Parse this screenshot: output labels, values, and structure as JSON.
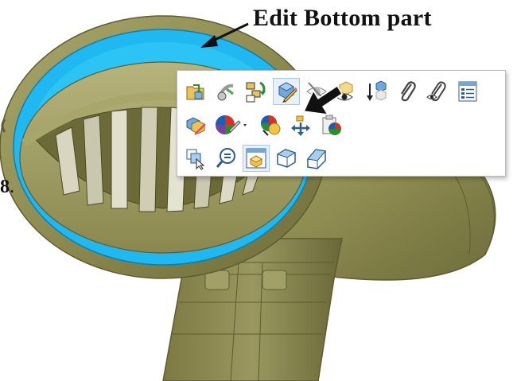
{
  "callout": {
    "text": "Edit Bottom part"
  },
  "step": {
    "number": "8",
    "suffix": "."
  },
  "colors": {
    "part_body": "#8c8a4e",
    "part_edge": "#5e5c30",
    "highlight_face": "#1fb8f0",
    "toolbar_bg": "#ffffff",
    "toolbar_border": "#b9b9b9",
    "hover_bg": "#e8f1fb"
  },
  "toolbar": {
    "rows": [
      {
        "icons": [
          "open-part-icon",
          "smart-mates-icon",
          "assembly-structure-icon",
          "edit-part-icon",
          "hide-components-icon",
          "isolate-icon",
          "move-down-icon",
          "attach-icon",
          "view-attachment-icon",
          "properties-icon"
        ]
      },
      {
        "icons": [
          "edit-component-icon",
          "appearance-icon",
          "change-transparency-icon",
          "move-component-icon",
          "component-appearance-icon"
        ]
      },
      {
        "icons": [
          "select-component-icon",
          "zoom-to-selection-icon",
          "insert-part-icon",
          "normal-to-face-icon",
          "view-orientation-icon"
        ]
      }
    ],
    "highlighted_icon": "edit-part-icon"
  }
}
